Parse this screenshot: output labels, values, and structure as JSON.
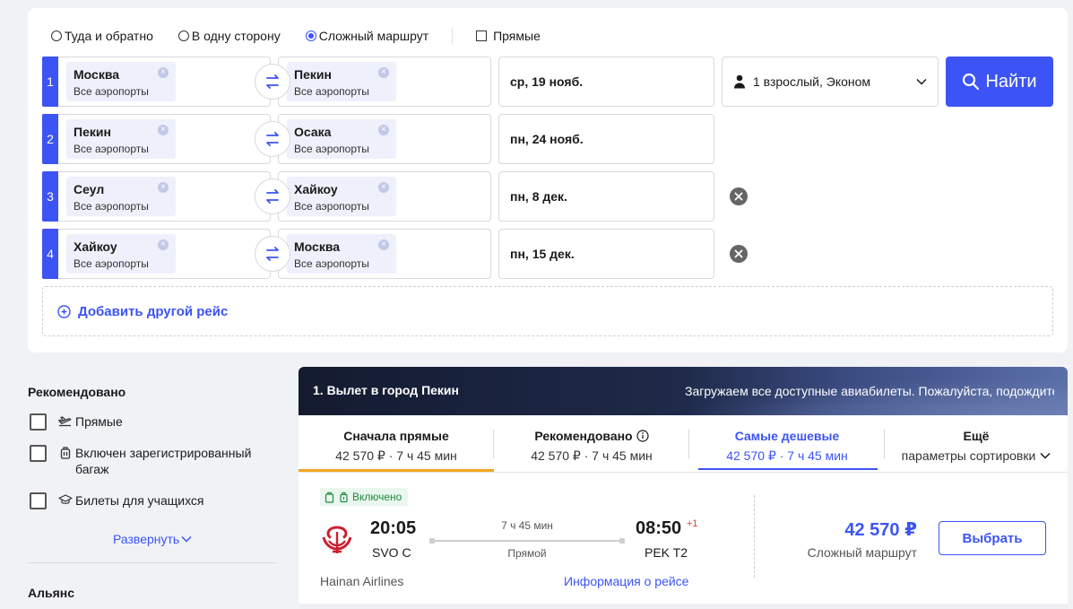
{
  "colors": {
    "accent": "#3c54f5",
    "sort_active_underline": "#f5a623",
    "included_green": "#1e8a3f",
    "airline_red": "#cc1f2f"
  },
  "trip_types": {
    "round_trip": "Туда и обратно",
    "one_way": "В одну сторону",
    "multi_city": "Сложный маршрут",
    "selected": "multi_city",
    "direct_label": "Прямые"
  },
  "legs": [
    {
      "num": "1",
      "from": {
        "city": "Москва",
        "airports": "Все аэропорты"
      },
      "to": {
        "city": "Пекин",
        "airports": "Все аэропорты"
      },
      "date": "ср, 19 нояб.",
      "removable": false
    },
    {
      "num": "2",
      "from": {
        "city": "Пекин",
        "airports": "Все аэропорты"
      },
      "to": {
        "city": "Осака",
        "airports": "Все аэропорты"
      },
      "date": "пн, 24 нояб.",
      "removable": false
    },
    {
      "num": "3",
      "from": {
        "city": "Сеул",
        "airports": "Все аэропорты"
      },
      "to": {
        "city": "Хайкоу",
        "airports": "Все аэропорты"
      },
      "date": "пн, 8 дек.",
      "removable": true
    },
    {
      "num": "4",
      "from": {
        "city": "Хайкоу",
        "airports": "Все аэропорты"
      },
      "to": {
        "city": "Москва",
        "airports": "Все аэропорты"
      },
      "date": "пн, 15 дек.",
      "removable": true
    }
  ],
  "passengers": {
    "label": "1 взрослый, Эконом",
    "icon": "person-icon"
  },
  "search": {
    "button_label": "Найти",
    "icon": "search-icon"
  },
  "add_leg": {
    "label": "Добавить другой рейс",
    "icon": "plus-circle-icon"
  },
  "filters": {
    "recommended_title": "Рекомендовано",
    "items": [
      {
        "label": "Прямые",
        "icon": "plane-takeoff-icon"
      },
      {
        "label": "Включен зарегистрированный багаж",
        "icon": "luggage-icon"
      },
      {
        "label": "Билеты для учащихся",
        "icon": "graduation-cap-icon"
      }
    ],
    "expand_label": "Развернуть",
    "alliance_title": "Альянс"
  },
  "results": {
    "title": "1. Вылет в город Пекин",
    "loading": "Загружаем все доступные авиабилеты. Пожалуйста, подождите...",
    "sort_tabs": [
      {
        "title": "Сначала прямые",
        "sub": "42 570 ₽ · 7 ч 45 мин"
      },
      {
        "title": "Рекомендовано",
        "sub": "42 570 ₽ · 7 ч 45 мин"
      },
      {
        "title": "Самые дешевые",
        "sub": "42 570 ₽ · 7 ч 45 мин"
      },
      {
        "title": "Ещё",
        "sub": "параметры сортировки"
      }
    ],
    "flight": {
      "badge": "Включено",
      "dep_time": "20:05",
      "dep_airport": "SVO C",
      "duration": "7 ч 45 мин",
      "stops": "Прямой",
      "arr_time": "08:50",
      "day_offset": "+1",
      "arr_airport": "PEK T2",
      "airline": "Hainan Airlines",
      "info_link": "Информация о рейсе",
      "price": "42 570 ₽",
      "price_note": "Сложный маршрут",
      "select_label": "Выбрать"
    }
  }
}
